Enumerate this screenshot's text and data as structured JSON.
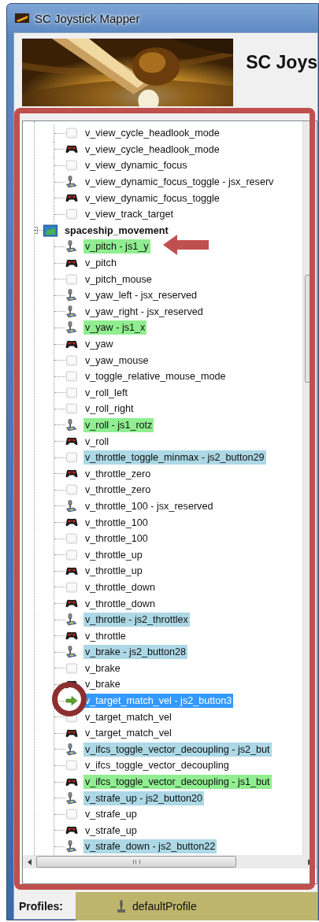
{
  "window": {
    "title": "SC Joystick Mapper"
  },
  "header": {
    "heading": "SC Joys"
  },
  "tree": {
    "nodes": [
      {
        "kind": "keyboard",
        "label": "v_view_cycle_headlook_mode",
        "selected": false
      },
      {
        "kind": "gamepad",
        "label": "v_view_cycle_headlook_mode",
        "selected": false
      },
      {
        "kind": "keyboard",
        "label": "v_view_dynamic_focus",
        "selected": false
      },
      {
        "kind": "joystick",
        "label": "v_view_dynamic_focus_toggle - jsx_reserv",
        "selected": false
      },
      {
        "kind": "gamepad",
        "label": "v_view_dynamic_focus_toggle",
        "selected": false
      },
      {
        "kind": "keyboard",
        "label": "v_view_track_target",
        "selected": false
      },
      {
        "kind": "group",
        "label": "spaceship_movement",
        "expanded": true,
        "selected": false,
        "children": [
          {
            "kind": "joystick",
            "label": "v_pitch - js1_y",
            "selected": false,
            "color": "#90ee90"
          },
          {
            "kind": "gamepad",
            "label": "v_pitch",
            "selected": false
          },
          {
            "kind": "keyboard",
            "label": "v_pitch_mouse",
            "selected": false
          },
          {
            "kind": "joystick",
            "label": "v_yaw_left - jsx_reserved",
            "selected": false
          },
          {
            "kind": "joystick",
            "label": "v_yaw_right - jsx_reserved",
            "selected": false
          },
          {
            "kind": "joystick",
            "label": "v_yaw - js1_x",
            "selected": false,
            "color": "#90ee90"
          },
          {
            "kind": "gamepad",
            "label": "v_yaw",
            "selected": false
          },
          {
            "kind": "keyboard",
            "label": "v_yaw_mouse",
            "selected": false
          },
          {
            "kind": "keyboard",
            "label": "v_toggle_relative_mouse_mode",
            "selected": false
          },
          {
            "kind": "keyboard",
            "label": "v_roll_left",
            "selected": false
          },
          {
            "kind": "keyboard",
            "label": "v_roll_right",
            "selected": false
          },
          {
            "kind": "joystick",
            "label": "v_roll - js1_rotz",
            "selected": false,
            "color": "#90ee90"
          },
          {
            "kind": "gamepad",
            "label": "v_roll",
            "selected": false
          },
          {
            "kind": "keyboard",
            "label": "v_throttle_toggle_minmax - js2_button29",
            "selected": false,
            "color": "#add8e6"
          },
          {
            "kind": "gamepad",
            "label": "v_throttle_zero",
            "selected": false
          },
          {
            "kind": "keyboard",
            "label": "v_throttle_zero",
            "selected": false
          },
          {
            "kind": "joystick",
            "label": "v_throttle_100 - jsx_reserved",
            "selected": false
          },
          {
            "kind": "gamepad",
            "label": "v_throttle_100",
            "selected": false
          },
          {
            "kind": "keyboard",
            "label": "v_throttle_100",
            "selected": false
          },
          {
            "kind": "keyboard",
            "label": "v_throttle_up",
            "selected": false
          },
          {
            "kind": "gamepad",
            "label": "v_throttle_up",
            "selected": false
          },
          {
            "kind": "keyboard",
            "label": "v_throttle_down",
            "selected": false
          },
          {
            "kind": "gamepad",
            "label": "v_throttle_down",
            "selected": false
          },
          {
            "kind": "joystick",
            "label": "v_throttle - js2_throttlex",
            "selected": false,
            "color": "#add8e6"
          },
          {
            "kind": "gamepad",
            "label": "v_throttle",
            "selected": false
          },
          {
            "kind": "joystick",
            "label": "v_brake - js2_button28",
            "selected": false,
            "color": "#add8e6"
          },
          {
            "kind": "keyboard",
            "label": "v_brake",
            "selected": false
          },
          {
            "kind": "gamepad",
            "label": "v_brake",
            "selected": false
          },
          {
            "kind": "arrow",
            "label": "v_target_match_vel - js2_button3",
            "selected": true
          },
          {
            "kind": "keyboard",
            "label": "v_target_match_vel",
            "selected": false
          },
          {
            "kind": "gamepad",
            "label": "v_target_match_vel",
            "selected": false
          },
          {
            "kind": "joystick",
            "label": "v_ifcs_toggle_vector_decoupling - js2_but",
            "selected": false,
            "color": "#add8e6"
          },
          {
            "kind": "keyboard",
            "label": "v_ifcs_toggle_vector_decoupling",
            "selected": false
          },
          {
            "kind": "gamepad",
            "label": "v_ifcs_toggle_vector_decoupling - js1_but",
            "selected": false,
            "color": "#90ee90"
          },
          {
            "kind": "joystick",
            "label": "v_strafe_up - js2_button20",
            "selected": false,
            "color": "#add8e6"
          },
          {
            "kind": "keyboard",
            "label": "v_strafe_up",
            "selected": false
          },
          {
            "kind": "gamepad",
            "label": "v_strafe_up",
            "selected": false
          },
          {
            "kind": "joystick",
            "label": "v_strafe_down - js2_button22",
            "selected": false,
            "color": "#add8e6"
          }
        ]
      }
    ]
  },
  "profiles": {
    "label": "Profiles:",
    "value": "defaultProfile"
  }
}
